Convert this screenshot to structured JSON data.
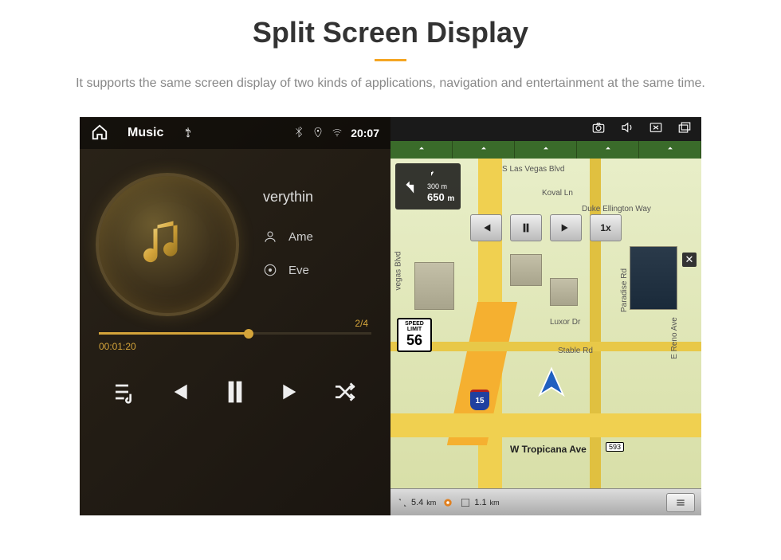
{
  "header": {
    "title": "Split Screen Display",
    "subtitle": "It supports the same screen display of two kinds of applications, navigation and entertainment at the same time."
  },
  "music": {
    "status_title": "Music",
    "clock": "20:07",
    "track_title": "verythin",
    "artist_partial": "Ame",
    "album_partial": "Eve",
    "elapsed": "00:01:20",
    "track_count": "2/4"
  },
  "nav": {
    "top_street": "S Las Vegas Blvd",
    "turn_distance": "650",
    "turn_unit": "m",
    "next_turn_dist": "300 m",
    "speed_limit_label": "SPEED LIMIT",
    "speed_limit_value": "56",
    "speed_btn": "1x",
    "interstate_number": "15",
    "tropicana": "W Tropicana Ave",
    "tropicana_tag": "593",
    "streets": {
      "koval": "Koval Ln",
      "duke": "Duke Ellington Way",
      "luxor": "Luxor Dr",
      "stable": "Stable Rd",
      "reno": "E Reno Ave",
      "paradise": "Paradise Rd",
      "vegas_side": "vegas Blvd"
    },
    "bottom": {
      "dist1": "5.4",
      "unit1": "km",
      "dist2": "1.1",
      "unit2": "km"
    }
  }
}
